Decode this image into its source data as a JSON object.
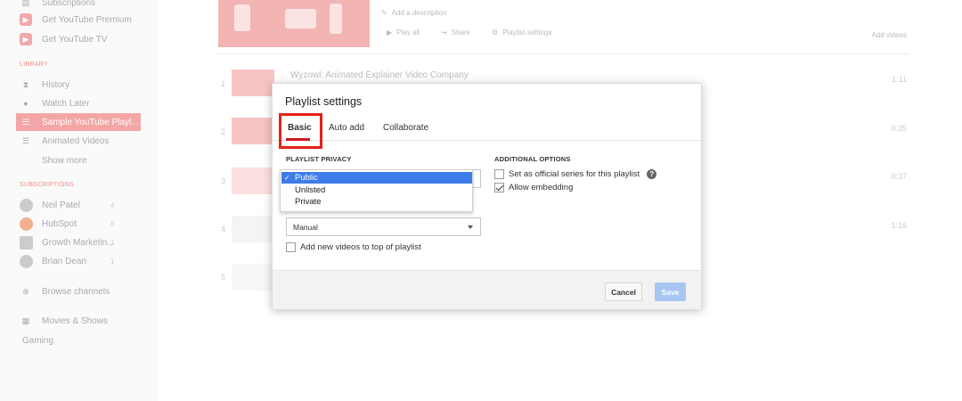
{
  "sidebar": {
    "top_items": [
      {
        "label": "Subscriptions",
        "icon": "subscriptions-icon"
      },
      {
        "label": "Get YouTube Premium",
        "icon": "youtube-icon"
      },
      {
        "label": "Get YouTube TV",
        "icon": "youtube-icon"
      }
    ],
    "library_heading": "LIBRARY",
    "library_items": [
      {
        "label": "History",
        "icon": "history-icon"
      },
      {
        "label": "Watch Later",
        "icon": "clock-icon"
      },
      {
        "label": "Sample YouTube Playl...",
        "icon": "playlist-icon"
      },
      {
        "label": "Animated Videos",
        "icon": "playlist-icon"
      }
    ],
    "show_more": "Show more",
    "subscriptions_heading": "SUBSCRIPTIONS",
    "subscriptions": [
      {
        "label": "Neil Patel",
        "count": "4"
      },
      {
        "label": "HubSpot",
        "count": "6"
      },
      {
        "label": "Growth Marketin...",
        "count": "1"
      },
      {
        "label": "Brian Dean",
        "count": "1"
      }
    ],
    "browse_channels": "Browse channels",
    "movies_shows": "Movies & Shows",
    "gaming": "Gaming"
  },
  "playlist_header": {
    "add_description": "Add a description",
    "play_all": "Play all",
    "share": "Share",
    "playlist_settings": "Playlist settings",
    "add_videos": "Add videos"
  },
  "videos": [
    {
      "num": "1",
      "title": "Wyzowl: Animated Explainer Video Company",
      "duration": "1:11"
    },
    {
      "num": "2",
      "title": "",
      "duration": "0:35"
    },
    {
      "num": "3",
      "title": "",
      "duration": "0:37"
    },
    {
      "num": "4",
      "title": "",
      "duration": "1:16"
    },
    {
      "num": "5",
      "title": "",
      "duration": ""
    }
  ],
  "dialog": {
    "title": "Playlist settings",
    "tabs": [
      "Basic",
      "Auto add",
      "Collaborate"
    ],
    "active_tab": "Basic",
    "privacy_label": "PLAYLIST PRIVACY",
    "privacy_options": [
      "Public",
      "Unlisted",
      "Private"
    ],
    "privacy_selected": "Public",
    "ordering_value": "Manual",
    "add_to_top_label": "Add new videos to top of playlist",
    "add_to_top_checked": false,
    "additional_label": "ADDITIONAL OPTIONS",
    "official_series_label": "Set as official series for this playlist",
    "official_series_checked": false,
    "allow_embedding_label": "Allow embedding",
    "allow_embedding_checked": true,
    "help_glyph": "?",
    "cancel_label": "Cancel",
    "save_label": "Save"
  },
  "colors": {
    "highlight_box": "#e62117",
    "selected_option": "#3d7ce9",
    "save_button": "#a8c6f2"
  }
}
